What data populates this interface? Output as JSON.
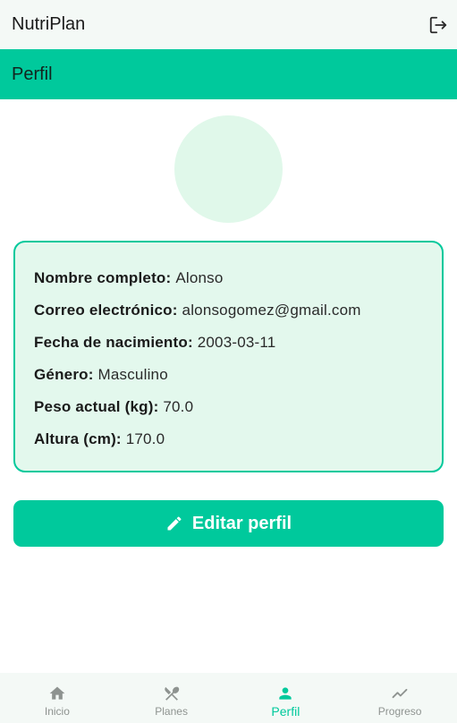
{
  "app": {
    "title": "NutriPlan"
  },
  "header": {
    "logout_icon": "logout-icon"
  },
  "section": {
    "title": "Perfil"
  },
  "profile": {
    "fields": [
      {
        "label": "Nombre completo:",
        "value": "Alonso"
      },
      {
        "label": "Correo electrónico:",
        "value": "alonsogomez@gmail.com"
      },
      {
        "label": "Fecha de nacimiento:",
        "value": "2003-03-11"
      },
      {
        "label": "Género:",
        "value": "Masculino"
      },
      {
        "label": "Peso actual (kg):",
        "value": "70.0"
      },
      {
        "label": "Altura (cm):",
        "value": "170.0"
      }
    ]
  },
  "actions": {
    "edit_label": "Editar perfil",
    "edit_icon": "pencil-icon"
  },
  "nav": {
    "items": [
      {
        "label": "Inicio",
        "icon": "home-icon",
        "active": false
      },
      {
        "label": "Planes",
        "icon": "utensils-icon",
        "active": false
      },
      {
        "label": "Perfil",
        "icon": "person-icon",
        "active": true
      },
      {
        "label": "Progreso",
        "icon": "trending-icon",
        "active": false
      }
    ]
  },
  "colors": {
    "accent": "#00c99c",
    "card_bg": "#e3f8ed",
    "avatar_bg": "#e0f8ea",
    "nav_inactive": "#8e9390"
  }
}
